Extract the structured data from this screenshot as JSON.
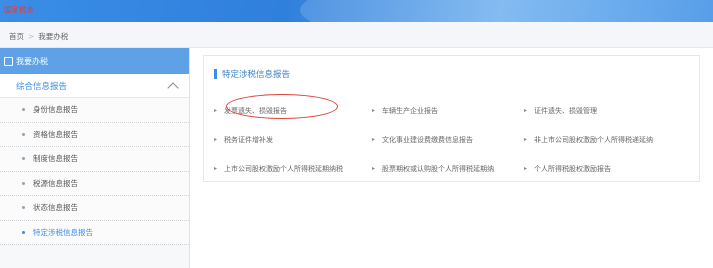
{
  "header": {
    "logo": "国家税务"
  },
  "breadcrumb": {
    "home": "首页",
    "separator": ">",
    "current": "我要办税"
  },
  "sidebar": {
    "title": "我要办税",
    "group_label": "综合信息报告",
    "items": [
      {
        "label": "身份信息报告"
      },
      {
        "label": "资格信息报告"
      },
      {
        "label": "制度信息报告"
      },
      {
        "label": "税源信息报告"
      },
      {
        "label": "状态信息报告"
      },
      {
        "label": "特定涉税信息报告"
      }
    ]
  },
  "main": {
    "panel_title": "特定涉税信息报告",
    "links": [
      [
        "发票遗失、损毁报告",
        "车辆生产企业报告",
        "证件遗失、损毁管理"
      ],
      [
        "税务证件增补发",
        "文化事业建设费缴费信息报告",
        "非上市公司股权激励个人所得税递延纳"
      ],
      [
        "上市公司股权激励个人所得税延期纳税",
        "股票期权或认购股个人所得税延期纳",
        "个人所得税股权激励报告"
      ]
    ]
  },
  "colors": {
    "accent": "#3a8ee6",
    "highlight_circle": "#d9443b"
  }
}
